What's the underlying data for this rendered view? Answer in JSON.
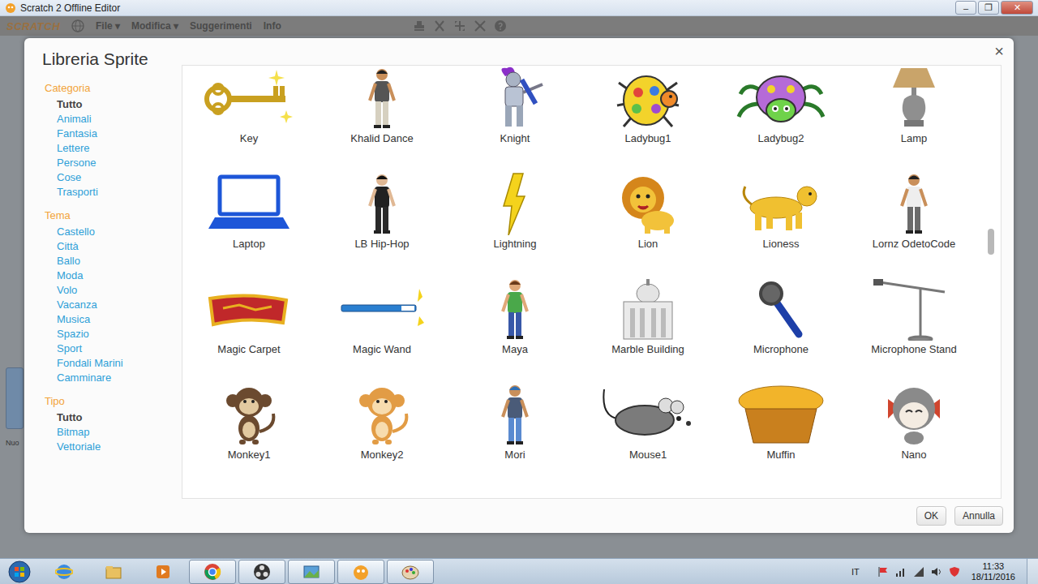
{
  "window": {
    "title": "Scratch 2 Offline Editor",
    "controls": [
      "–",
      "❐",
      "✕"
    ]
  },
  "menu": {
    "logo": "SCRATCH",
    "items": [
      "File ▾",
      "Modifica ▾",
      "Suggerimenti",
      "Info"
    ]
  },
  "editor": {
    "fragment": "Nuo"
  },
  "dialog": {
    "title": "Libreria Sprite",
    "close": "×",
    "filters": [
      {
        "heading": "Categoria",
        "items": [
          {
            "label": "Tutto",
            "selected": true
          },
          {
            "label": "Animali",
            "selected": false
          },
          {
            "label": "Fantasia",
            "selected": false
          },
          {
            "label": "Lettere",
            "selected": false
          },
          {
            "label": "Persone",
            "selected": false
          },
          {
            "label": "Cose",
            "selected": false
          },
          {
            "label": "Trasporti",
            "selected": false
          }
        ]
      },
      {
        "heading": "Tema",
        "items": [
          {
            "label": "Castello",
            "selected": false
          },
          {
            "label": "Città",
            "selected": false
          },
          {
            "label": "Ballo",
            "selected": false
          },
          {
            "label": "Moda",
            "selected": false
          },
          {
            "label": "Volo",
            "selected": false
          },
          {
            "label": "Vacanza",
            "selected": false
          },
          {
            "label": "Musica",
            "selected": false
          },
          {
            "label": "Spazio",
            "selected": false
          },
          {
            "label": "Sport",
            "selected": false
          },
          {
            "label": "Fondali Marini",
            "selected": false
          },
          {
            "label": "Camminare",
            "selected": false
          }
        ]
      },
      {
        "heading": "Tipo",
        "items": [
          {
            "label": "Tutto",
            "selected": true
          },
          {
            "label": "Bitmap",
            "selected": false
          },
          {
            "label": "Vettoriale",
            "selected": false
          }
        ]
      }
    ],
    "sprites": [
      {
        "name": "Key"
      },
      {
        "name": "Khalid Dance"
      },
      {
        "name": "Knight"
      },
      {
        "name": "Ladybug1"
      },
      {
        "name": "Ladybug2"
      },
      {
        "name": "Lamp"
      },
      {
        "name": "Laptop"
      },
      {
        "name": "LB Hip-Hop"
      },
      {
        "name": "Lightning"
      },
      {
        "name": "Lion"
      },
      {
        "name": "Lioness"
      },
      {
        "name": "Lornz OdetoCode"
      },
      {
        "name": "Magic Carpet"
      },
      {
        "name": "Magic Wand"
      },
      {
        "name": "Maya"
      },
      {
        "name": "Marble Building"
      },
      {
        "name": "Microphone"
      },
      {
        "name": "Microphone Stand"
      },
      {
        "name": "Monkey1"
      },
      {
        "name": "Monkey2"
      },
      {
        "name": "Mori"
      },
      {
        "name": "Mouse1"
      },
      {
        "name": "Muffin"
      },
      {
        "name": "Nano"
      }
    ],
    "scrollbar": {
      "level": 0.4
    },
    "buttons": [
      "OK",
      "Annulla"
    ]
  },
  "taskbar": {
    "apps": [
      {
        "active": false
      },
      {
        "active": false
      },
      {
        "active": false
      },
      {
        "active": true
      },
      {
        "active": true
      },
      {
        "active": true
      },
      {
        "active": true
      },
      {
        "active": true
      }
    ],
    "language": "IT",
    "time": "11:33",
    "date": "18/11/2016"
  }
}
